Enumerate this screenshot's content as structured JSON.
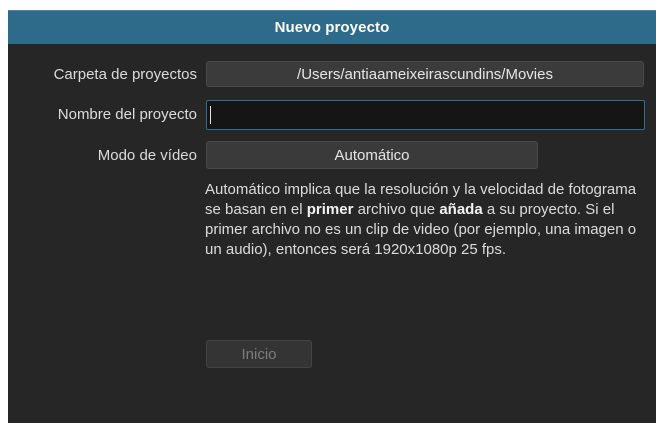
{
  "dialog": {
    "title": "Nuevo proyecto"
  },
  "form": {
    "folder_label": "Carpeta de proyectos",
    "folder_value": "/Users/antiaameixeirascundins/Movies",
    "name_label": "Nombre del proyecto",
    "name_value": "",
    "mode_label": "Modo de vídeo",
    "mode_value": "Automático"
  },
  "description": {
    "part1": "Automático implica que la resolución y la velocidad de fotograma se basan en el ",
    "bold1": "primer",
    "part2": " archivo que ",
    "bold2": "añada",
    "part3": " a su proyecto. Si el primer archivo no es un clip de video (por ejemplo, una imagen o un audio), entonces será 1920x1080p 25 fps."
  },
  "actions": {
    "start_label": "Inicio"
  },
  "colors": {
    "titlebar": "#2e6a8a",
    "background": "#262626",
    "input_focus_border": "#2f6f8f"
  }
}
